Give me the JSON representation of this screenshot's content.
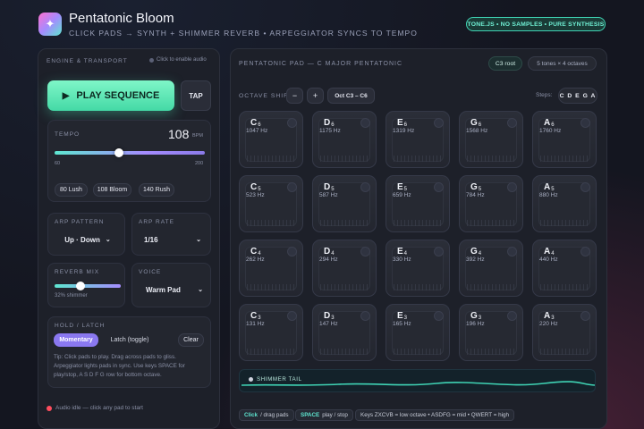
{
  "header": {
    "title": "Pentatonic Bloom",
    "subtitle": "CLICK PADS → SYNTH + SHIMMER REVERB • ARPEGGIATOR SYNCS TO TEMPO",
    "engine_badge": "TONE.JS • NO SAMPLES • PURE SYNTHESIS"
  },
  "left": {
    "title": "ENGINE & TRANSPORT",
    "audio_hint": "Click to enable audio",
    "play_label": "PLAY SEQUENCE",
    "tap_label": "TAP",
    "tempo": {
      "label": "TEMPO",
      "value": "108",
      "unit": "BPM",
      "min": "60",
      "max": "200",
      "slider_fraction": 0.43,
      "presets": [
        "80 Lush",
        "108 Bloom",
        "140 Rush"
      ]
    },
    "arp_pattern": {
      "label": "ARP PATTERN",
      "value": "Up · Down"
    },
    "arp_rate": {
      "label": "ARP RATE",
      "value": "1/16"
    },
    "reverb": {
      "label": "REVERB MIX",
      "caption": "32% shimmer",
      "fraction": 0.32
    },
    "voice": {
      "label": "VOICE",
      "value": "Warm Pad"
    },
    "hold": {
      "label": "HOLD / LATCH",
      "momentary": "Momentary",
      "latch": "Latch (toggle)",
      "clear": "Clear",
      "tip": "Tip: Click pads to play. Drag across pads to gliss. Arpeggiator lights pads in sync. Use keys SPACE for play/stop, A S D F G row for bottom octave."
    },
    "status": "Audio idle — click any pad to start"
  },
  "right": {
    "title": "PENTATONIC PAD — C MAJOR PENTATONIC",
    "root_badge": "C3 root",
    "info_badge": "5 tones × 4 octaves",
    "octave_label": "OCTAVE SHIFT",
    "minus": "−",
    "plus": "+",
    "octave_range": "Oct C3 – C6",
    "steps_label": "Steps:",
    "steps_value": "C D E G A",
    "pads": [
      [
        {
          "n": "C",
          "o": "6",
          "hz": "1047 Hz"
        },
        {
          "n": "D",
          "o": "6",
          "hz": "1175 Hz"
        },
        {
          "n": "E",
          "o": "6",
          "hz": "1319 Hz"
        },
        {
          "n": "G",
          "o": "6",
          "hz": "1568 Hz"
        },
        {
          "n": "A",
          "o": "6",
          "hz": "1760 Hz"
        }
      ],
      [
        {
          "n": "C",
          "o": "5",
          "hz": "523 Hz"
        },
        {
          "n": "D",
          "o": "5",
          "hz": "587 Hz"
        },
        {
          "n": "E",
          "o": "5",
          "hz": "659 Hz"
        },
        {
          "n": "G",
          "o": "5",
          "hz": "784 Hz"
        },
        {
          "n": "A",
          "o": "5",
          "hz": "880 Hz"
        }
      ],
      [
        {
          "n": "C",
          "o": "4",
          "hz": "262 Hz"
        },
        {
          "n": "D",
          "o": "4",
          "hz": "294 Hz"
        },
        {
          "n": "E",
          "o": "4",
          "hz": "330 Hz"
        },
        {
          "n": "G",
          "o": "4",
          "hz": "392 Hz"
        },
        {
          "n": "A",
          "o": "4",
          "hz": "440 Hz"
        }
      ],
      [
        {
          "n": "C",
          "o": "3",
          "hz": "131 Hz"
        },
        {
          "n": "D",
          "o": "3",
          "hz": "147 Hz"
        },
        {
          "n": "E",
          "o": "3",
          "hz": "165 Hz"
        },
        {
          "n": "G",
          "o": "3",
          "hz": "196 Hz"
        },
        {
          "n": "A",
          "o": "3",
          "hz": "220 Hz"
        }
      ]
    ],
    "shimmer_label": "SHIMMER TAIL",
    "hints": [
      {
        "key": "Click",
        "text": "/ drag pads"
      },
      {
        "key": "SPACE",
        "text": "play / stop"
      },
      {
        "key": "",
        "text": "Keys ZXCVB = low octave • ASDFG = mid • QWERT = high"
      }
    ]
  },
  "colors": {
    "accent": "#5ee6d0",
    "play": "#5ef0b8",
    "momentary": "#8a78f0",
    "status_dot": "#ff4d5e"
  }
}
